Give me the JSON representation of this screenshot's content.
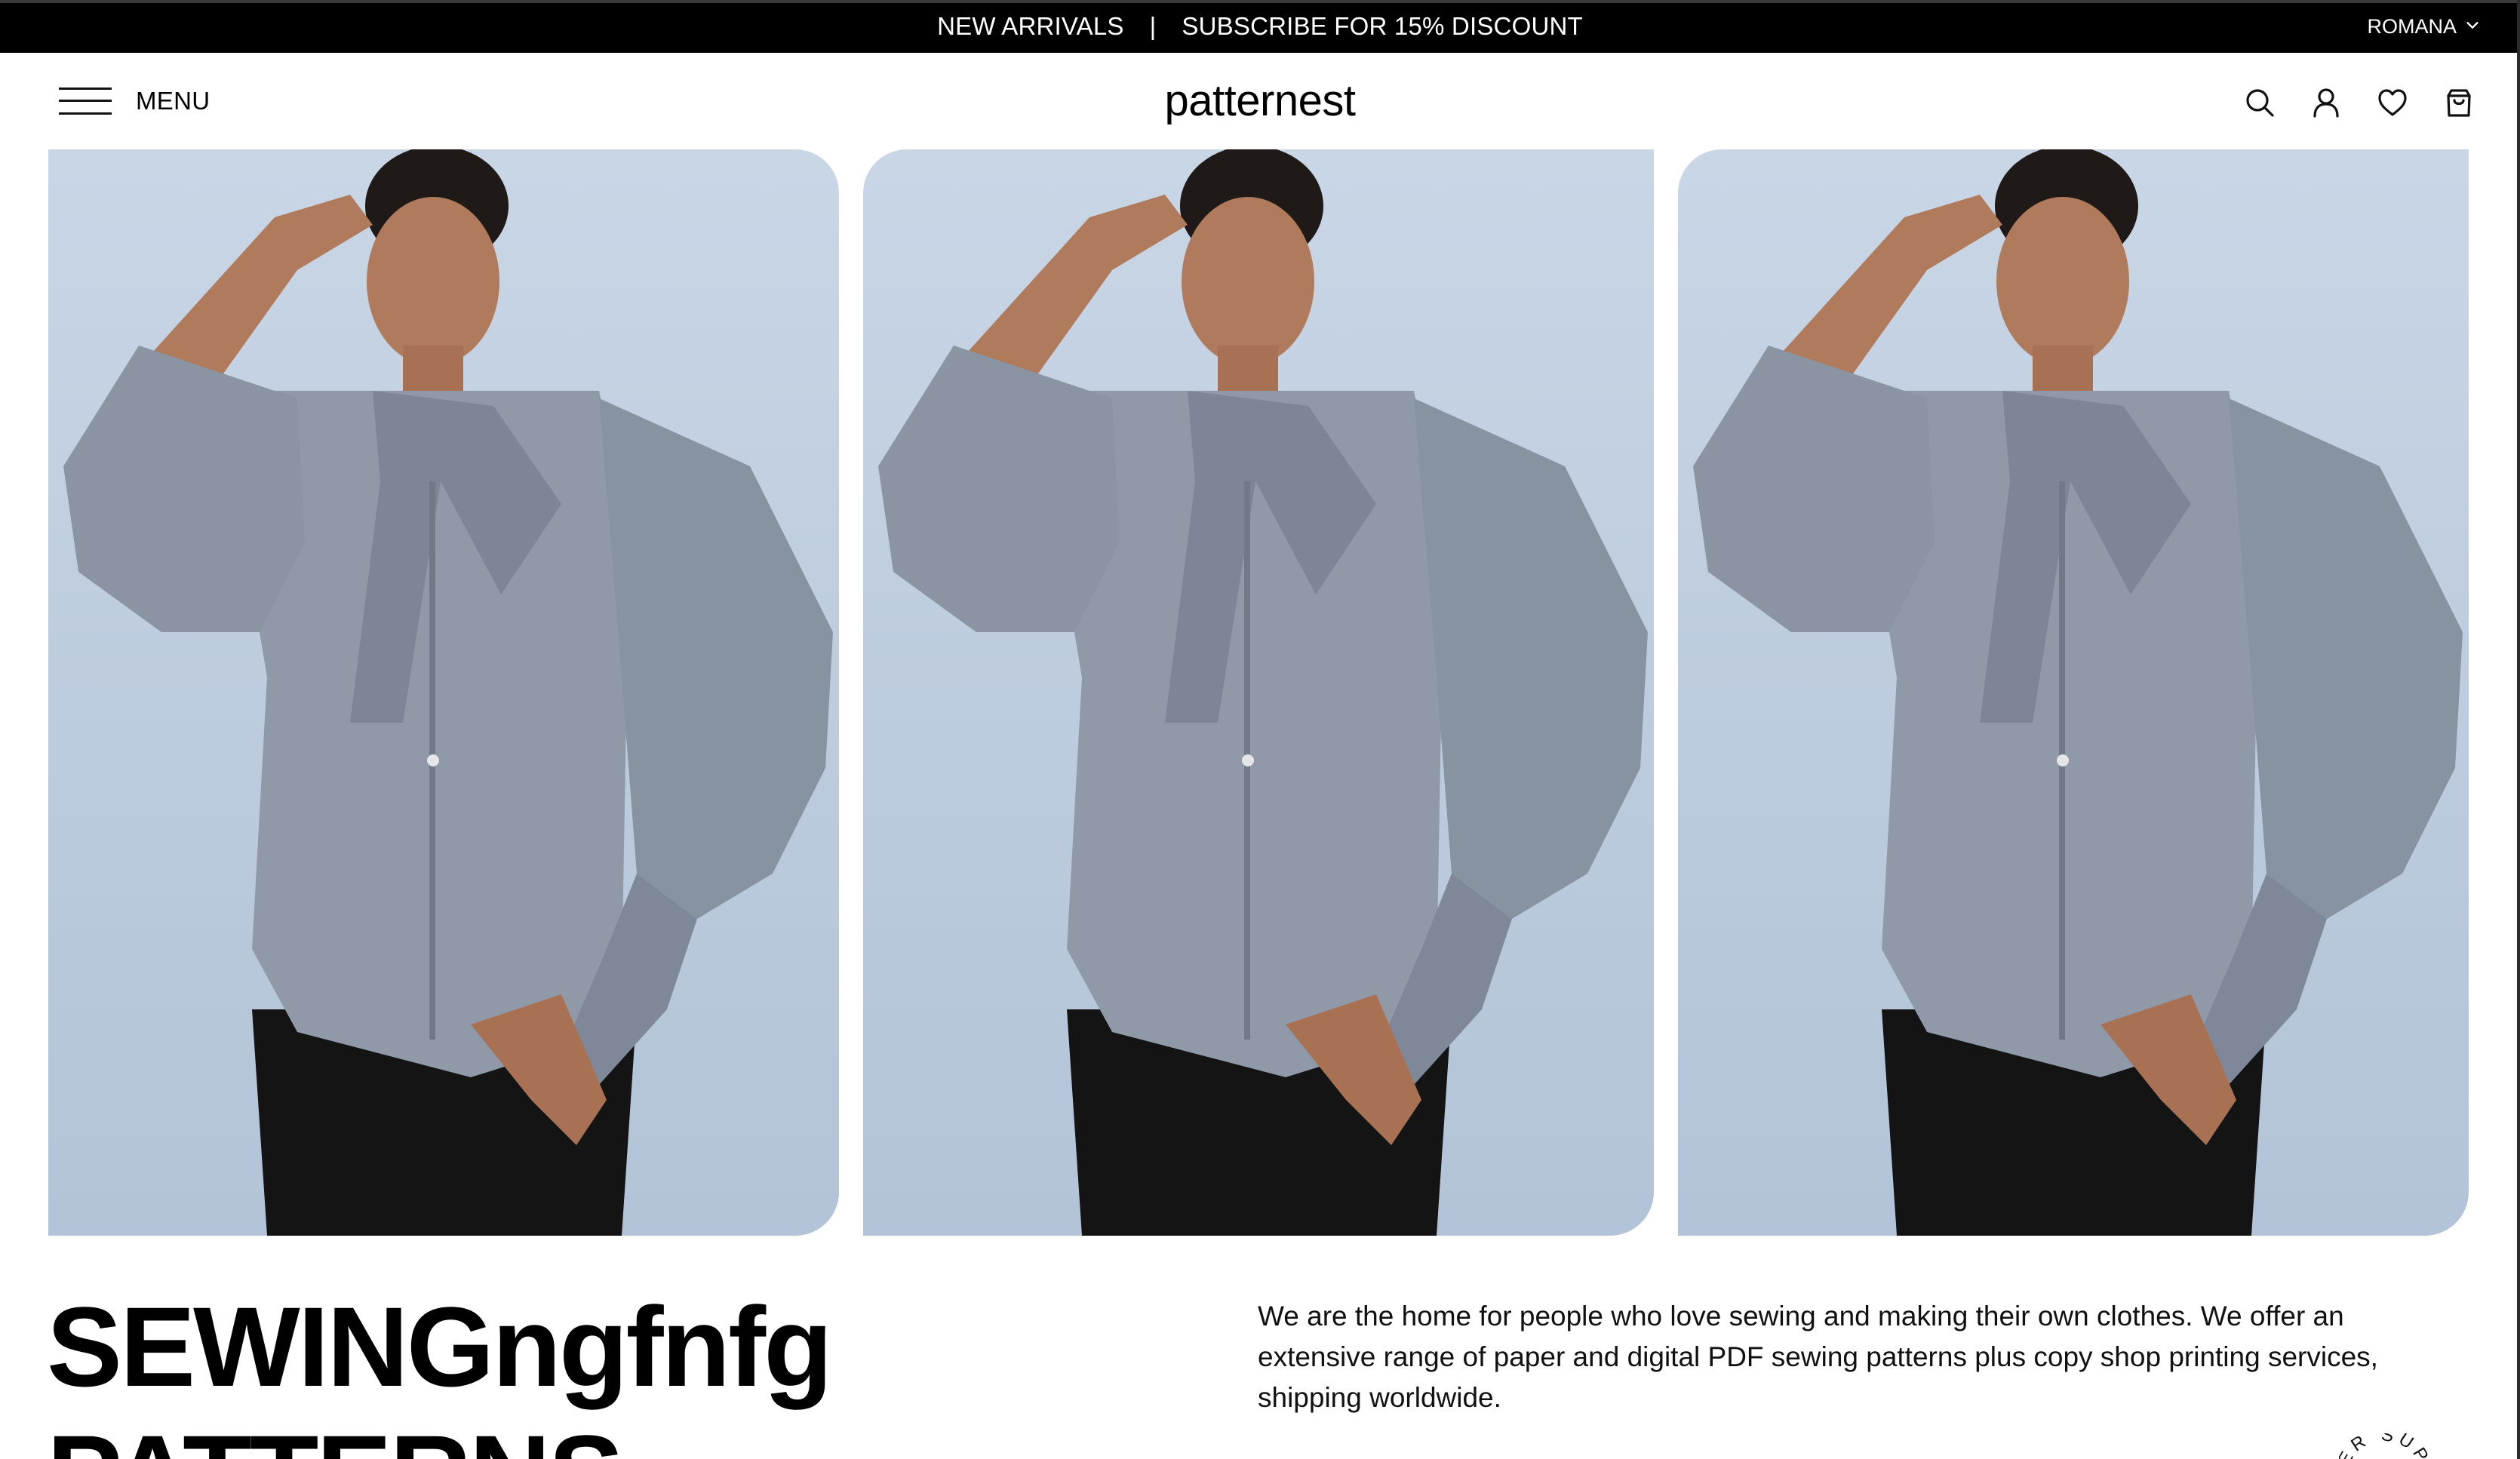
{
  "announcement": {
    "left_text": "NEW ARRIVALS",
    "separator": "|",
    "right_text": "SUBSCRIBE FOR 15% DISCOUNT"
  },
  "language": {
    "current": "ROMANA",
    "icon": "chevron-down-icon"
  },
  "header": {
    "menu_label": "MENU",
    "menu_icon": "hamburger-icon",
    "logo": "patternest",
    "actions": [
      {
        "name": "search",
        "icon": "search-icon"
      },
      {
        "name": "account",
        "icon": "user-icon"
      },
      {
        "name": "wishlist",
        "icon": "heart-icon"
      },
      {
        "name": "cart",
        "icon": "shopping-bag-icon"
      }
    ]
  },
  "hero": {
    "images": [
      {
        "name": "model-photo"
      },
      {
        "name": "model-photo"
      },
      {
        "name": "model-photo"
      }
    ]
  },
  "intro": {
    "headline_line1": "SEWINGngfnfg",
    "headline_line2": "PATTERNS",
    "description": "We are the home for people who love sewing and making their own clothes. We offer an extensive range of paper and digital PDF sewing patterns plus copy shop printing services, shipping worldwide.",
    "badge_text": "ER SUP"
  }
}
